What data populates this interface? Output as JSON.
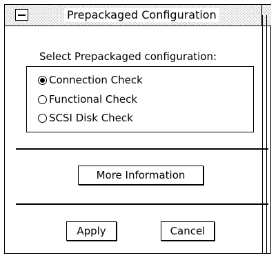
{
  "window": {
    "title": "Prepackaged Configuration",
    "menu_icon": "window-menu-icon"
  },
  "dialog": {
    "prompt": "Select Prepackaged configuration:",
    "options": [
      {
        "label": "Connection Check",
        "selected": true
      },
      {
        "label": "Functional Check",
        "selected": false
      },
      {
        "label": "SCSI Disk Check",
        "selected": false
      }
    ],
    "more_info_label": "More Information",
    "apply_label": "Apply",
    "cancel_label": "Cancel"
  }
}
